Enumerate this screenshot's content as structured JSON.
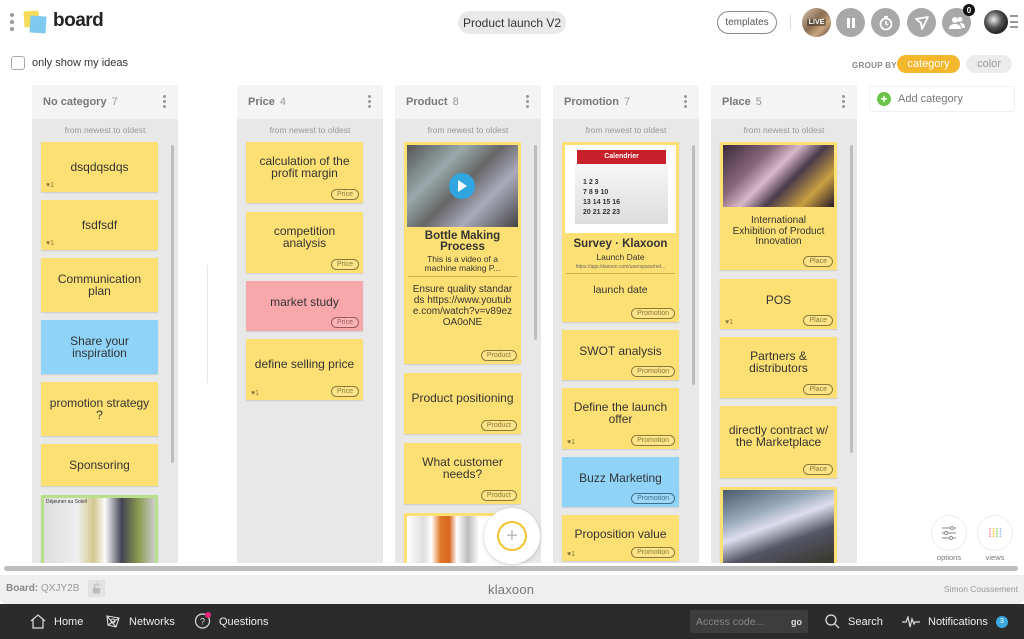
{
  "header": {
    "app_title": "board",
    "board_name": "Product launch V2",
    "templates_label": "templates",
    "live_label": "LIVE",
    "participants_count": "0"
  },
  "filters": {
    "only_my_ideas_label": "only show my ideas",
    "only_my_ideas_checked": false,
    "group_by_label": "GROUP BY",
    "group_by_options": [
      "category",
      "color"
    ],
    "group_by_selected": "category"
  },
  "columns": [
    {
      "title": "No category",
      "count": "7",
      "sort": "from newest to oldest",
      "cards": [
        {
          "text": "dsqdqsdqs",
          "color": "yellow",
          "likes": "1"
        },
        {
          "text": "fsdfsdf",
          "color": "yellow",
          "likes": "1"
        },
        {
          "text": "Communication plan",
          "color": "yellow"
        },
        {
          "text": "Share your inspiration",
          "color": "blue"
        },
        {
          "text": "promotion strategy ?",
          "color": "yellow"
        },
        {
          "text": "Sponsoring",
          "color": "yellow"
        },
        {
          "text": "",
          "color": "green",
          "image": "moodboard-image",
          "image_caption": "Déjeuner au Soleil"
        }
      ]
    },
    {
      "title": "Price",
      "count": "4",
      "sort": "from newest to oldest",
      "cards": [
        {
          "text": "calculation of the profit margin",
          "color": "yellow",
          "tag": "Price"
        },
        {
          "text": "competition analysis",
          "color": "yellow",
          "tag": "Price"
        },
        {
          "text": "market study",
          "color": "pink",
          "tag": "Price"
        },
        {
          "text": "define selling price",
          "color": "yellow",
          "tag": "Price",
          "likes": "1"
        }
      ]
    },
    {
      "title": "Product",
      "count": "8",
      "sort": "from newest to oldest",
      "cards": [
        {
          "link_title": "Bottle Making Process",
          "link_desc": "This is a video of a machine making P...",
          "text": "Ensure quality standards https://www.youtube.com/watch?v=v89ezOA0oNE",
          "color": "yellow",
          "tag": "Product",
          "image": "video-thumbnail"
        },
        {
          "text": "Product positioning",
          "color": "yellow",
          "tag": "Product"
        },
        {
          "text": "What customer needs?",
          "color": "yellow",
          "tag": "Product"
        },
        {
          "text": "",
          "color": "yellow",
          "image": "vacuum-sketches"
        }
      ]
    },
    {
      "title": "Promotion",
      "count": "7",
      "sort": "from newest to oldest",
      "cards": [
        {
          "link_title": "Survey · Klaxoon",
          "link_subtitle": "Launch Date",
          "link_url": "https://app.klaxoon.com/userspace/net...",
          "text": "launch date",
          "color": "yellow",
          "tag": "Promotion",
          "image": "calendar-image",
          "image_caption": "Calendrier"
        },
        {
          "text": "SWOT analysis",
          "color": "yellow",
          "tag": "Promotion"
        },
        {
          "text": "Define the launch offer",
          "color": "yellow",
          "tag": "Promotion",
          "likes": "1"
        },
        {
          "text": "Buzz Marketing",
          "color": "blue",
          "tag": "Promotion"
        },
        {
          "text": "Proposition value",
          "color": "yellow",
          "tag": "Promotion",
          "likes": "1"
        }
      ]
    },
    {
      "title": "Place",
      "count": "5",
      "sort": "from newest to oldest",
      "cards": [
        {
          "text": "International Exhibition of Product Innovation",
          "color": "yellow",
          "tag": "Place",
          "image": "exhibition-hall"
        },
        {
          "text": "POS",
          "color": "yellow",
          "tag": "Place",
          "likes": "1"
        },
        {
          "text": "Partners & distributors",
          "color": "yellow",
          "tag": "Place"
        },
        {
          "text": "directly contract w/ the Marketplace",
          "color": "yellow",
          "tag": "Place"
        },
        {
          "text": "",
          "color": "yellow",
          "image": "trade-show-booth"
        }
      ]
    }
  ],
  "add_category_label": "Add category",
  "tools": {
    "options_label": "options",
    "views_label": "views"
  },
  "footer": {
    "board_label": "Board:",
    "board_code": "QXJY2B",
    "brand": "klaxoon",
    "owner": "Simon Coussement"
  },
  "nav": {
    "home": "Home",
    "networks": "Networks",
    "questions": "Questions",
    "access_placeholder": "Access code...",
    "go": "go",
    "search": "Search",
    "notifications": "Notifications",
    "notifications_count": "3"
  },
  "colors": {
    "accent": "#f4b62b",
    "card_yellow": "#fde074",
    "card_blue": "#8fd3f8",
    "card_pink": "#f8a7ab",
    "add_green": "#6cc24a",
    "notif_blue": "#39a9e0"
  }
}
